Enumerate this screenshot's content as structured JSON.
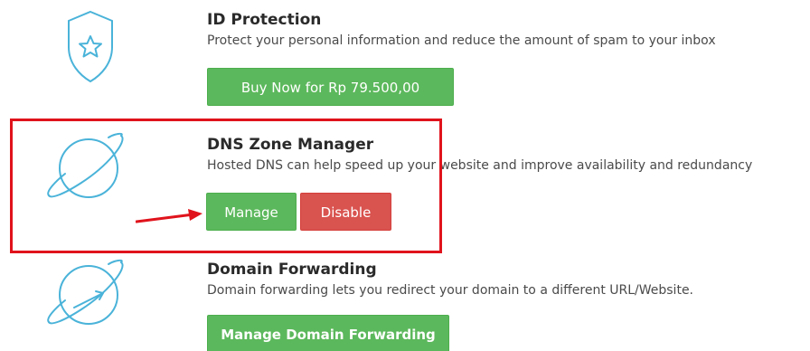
{
  "colors": {
    "icon_stroke": "#4ab3d9",
    "button_green": "#5cb85c",
    "button_red": "#d9534f",
    "highlight": "#e0131c"
  },
  "addons": [
    {
      "icon": "shield-star-icon",
      "title": "ID Protection",
      "description": "Protect your personal information and reduce the amount of spam to your inbox",
      "buttons": [
        {
          "label": "Buy Now for Rp 79.500,00"
        }
      ]
    },
    {
      "icon": "planet-icon",
      "title": "DNS Zone Manager",
      "description": "Hosted DNS can help speed up your website and improve availability and redundancy",
      "buttons": [
        {
          "label": "Manage"
        },
        {
          "label": "Disable"
        }
      ]
    },
    {
      "icon": "planet-forward-icon",
      "title": "Domain Forwarding",
      "description": "Domain forwarding lets you redirect your domain to a different URL/Website.",
      "buttons": [
        {
          "label": "Manage Domain Forwarding"
        }
      ]
    }
  ],
  "annotation": {
    "type": "red-box-with-arrow",
    "target": "Manage"
  }
}
